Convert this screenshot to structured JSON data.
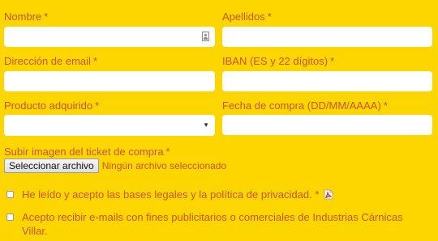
{
  "form": {
    "required_mark": "*",
    "nombre": {
      "label": "Nombre",
      "value": ""
    },
    "apellidos": {
      "label": "Apellidos",
      "value": ""
    },
    "email": {
      "label": "Dirección de email",
      "value": ""
    },
    "iban": {
      "label": "IBAN (ES y 22 dígitos)",
      "value": ""
    },
    "producto": {
      "label": "Producto adquirido",
      "selected": "",
      "arrow": "▼"
    },
    "fecha": {
      "label": "Fecha de compra (DD/MM/AAAA)",
      "value": ""
    },
    "ticket": {
      "label": "Subir imagen del ticket de compra",
      "button_label": "Seleccionar archivo",
      "status": "Ningún archivo seleccionado"
    },
    "legal": {
      "text": "He leído y acepto las bases legales y la política de privacidad.",
      "checked": false,
      "icon": "pdf-icon"
    },
    "marketing": {
      "text": "Acepto recibir e-mails con fines publicitarios o comerciales de Industrias Cárnicas Villar.",
      "checked": false
    }
  },
  "colors": {
    "background": "#FDD600",
    "label": "#C8561E",
    "input_background": "#FFFFFF",
    "pdf_red": "#D42020"
  }
}
